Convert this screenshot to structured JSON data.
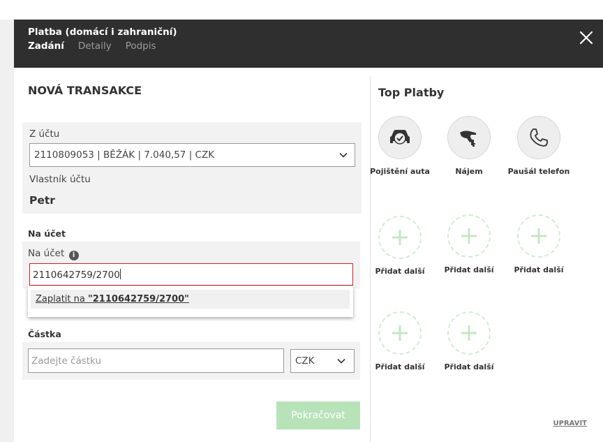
{
  "header": {
    "title": "Platba (domácí i zahraniční)",
    "tabs": [
      {
        "label": "Zadání"
      },
      {
        "label": "Detaily"
      },
      {
        "label": "Podpis"
      }
    ]
  },
  "form": {
    "section_title": "NOVÁ TRANSAKCE",
    "from_account": {
      "label": "Z účtu",
      "value": "2110809053 | BĚŽÁK | 7.040,57 | CZK"
    },
    "owner": {
      "label": "Vlastník účtu",
      "value": "Petr"
    },
    "to_account": {
      "heading": "Na účet",
      "label": "Na účet",
      "value": "2110642759/2700",
      "suggestion_prefix": "Zaplatit na ",
      "suggestion_value": "\"2110642759/2700\""
    },
    "amount": {
      "heading": "Částka",
      "placeholder": "Zadejte částku",
      "currency": "CZK"
    },
    "continue_label": "Pokračovat"
  },
  "top_payments": {
    "title": "Top Platby",
    "items": [
      {
        "label": "Pojištění auta",
        "icon": "car-shield-icon"
      },
      {
        "label": "Nájem",
        "icon": "key-hand-icon"
      },
      {
        "label": "Paušál telefon",
        "icon": "phone-icon"
      },
      {
        "label": "Přidat další",
        "icon": "plus-icon"
      },
      {
        "label": "Přidat další",
        "icon": "plus-icon"
      },
      {
        "label": "Přidat další",
        "icon": "plus-icon"
      },
      {
        "label": "Přidat další",
        "icon": "plus-icon"
      },
      {
        "label": "Přidat další",
        "icon": "plus-icon"
      }
    ],
    "edit_label": "UPRAVIT"
  },
  "colors": {
    "header_bg": "#2f2f2f",
    "error_border": "#cc2128",
    "continue_btn": "#b8e3b9",
    "dashed_circle": "#d3ead3",
    "plus_icon": "#c5e5c5"
  }
}
